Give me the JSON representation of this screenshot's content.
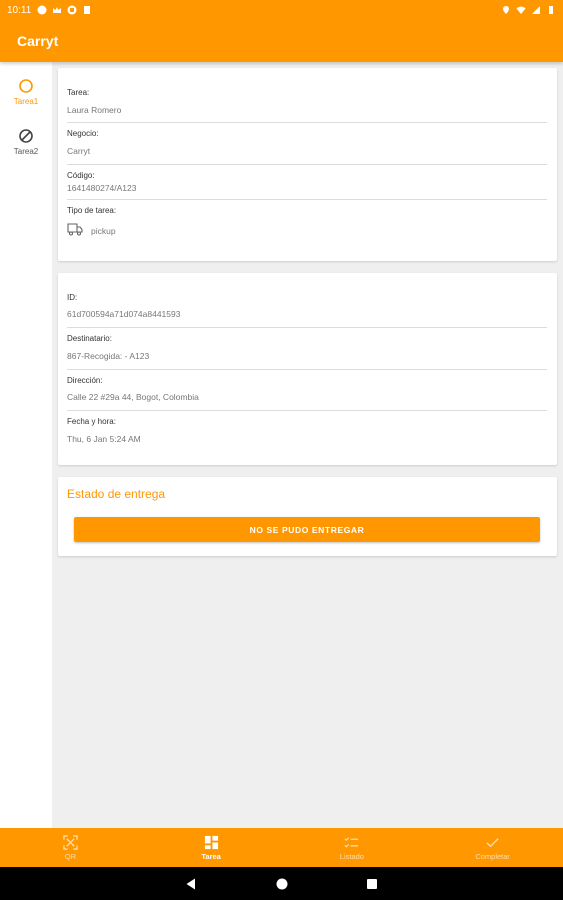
{
  "status_bar": {
    "time": "10:11"
  },
  "app": {
    "title": "Carryt"
  },
  "rail": [
    {
      "label": "Tarea1",
      "icon": "circle-outline-icon",
      "color": "#ff9800"
    },
    {
      "label": "Tarea2",
      "icon": "block-icon",
      "color": "#555555"
    }
  ],
  "task_card": {
    "fields": [
      {
        "label": "Tarea:",
        "value": "Laura Romero"
      },
      {
        "label": "Negocio:",
        "value": "Carryt"
      },
      {
        "label": "Código:",
        "value": "1641480274/A123"
      },
      {
        "label": "Tipo de tarea:",
        "value": "pickup"
      }
    ]
  },
  "detail_card": {
    "fields": [
      {
        "label": "ID:",
        "value": "61d700594a71d074a8441593"
      },
      {
        "label": "Destinatario:",
        "value": "867-Recogida: - A123"
      },
      {
        "label": "Dirección:",
        "value": "Calle 22 #29a 44, Bogot, Colombia"
      },
      {
        "label": "Fecha y hora:",
        "value": "Thu, 6 Jan 5:24 AM"
      }
    ]
  },
  "delivery": {
    "title": "Estado de entrega",
    "button_label": "NO SE PUDO ENTREGAR"
  },
  "bottom_nav": [
    {
      "label": "QR",
      "icon": "qr-scan-icon",
      "active": false
    },
    {
      "label": "Tarea",
      "icon": "dashboard-icon",
      "active": true
    },
    {
      "label": "Listado",
      "icon": "checklist-icon",
      "active": false
    },
    {
      "label": "Completar",
      "icon": "check-icon",
      "active": false
    }
  ],
  "colors": {
    "accent": "#ff9800",
    "background": "#efefef"
  }
}
